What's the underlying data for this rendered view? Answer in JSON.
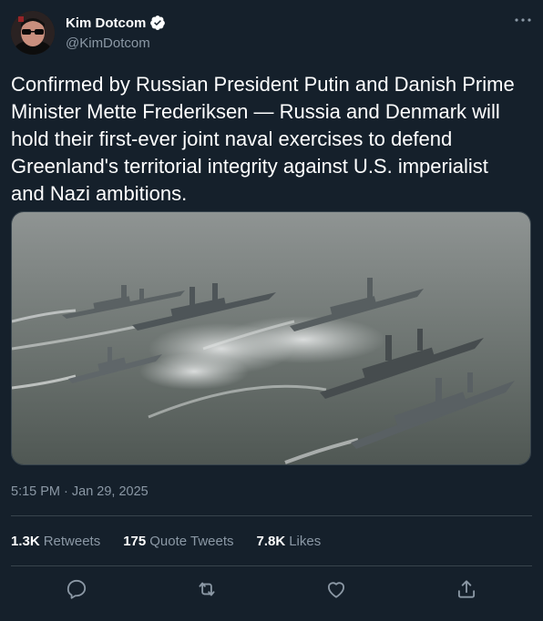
{
  "author": {
    "display_name": "Kim Dotcom",
    "handle": "@KimDotcom"
  },
  "tweet": {
    "text_lines": [
      "Confirmed by Russian President Putin and Danish Prime",
      "Minister Mette Frederiksen — Russia and Denmark will",
      "hold their first-ever joint naval exercises to defend",
      "Greenland's territorial integrity against U.S. imperialist",
      "and Nazi ambitions."
    ],
    "timestamp": "5:15 PM · Jan 29, 2025"
  },
  "stats": {
    "retweets_count": "1.3K",
    "retweets_label": "Retweets",
    "quotes_count": "175",
    "quotes_label": "Quote Tweets",
    "likes_count": "7.8K",
    "likes_label": "Likes"
  },
  "icons": {
    "verified": "verified-badge-icon",
    "more": "more-options-icon",
    "reply": "reply-icon",
    "retweet": "retweet-icon",
    "like": "heart-icon",
    "share": "share-icon"
  },
  "colors": {
    "background": "#15202b",
    "secondary_text": "#8b98a5",
    "divider": "#38444d"
  }
}
